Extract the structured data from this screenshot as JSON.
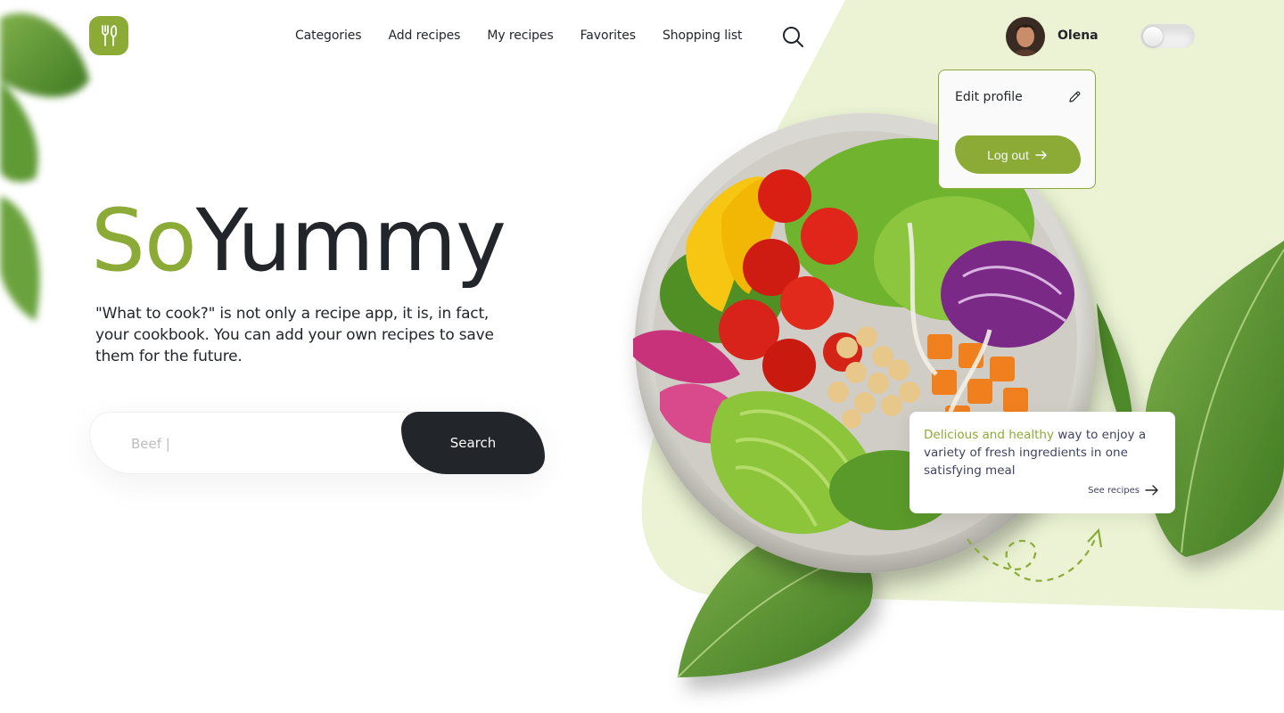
{
  "colors": {
    "accent": "#8baa36",
    "dark": "#22252a",
    "light_green": "#ebf3d4",
    "muted_text": "#bdbdbd"
  },
  "header": {
    "logo_icon": "fork-knife-icon",
    "nav": [
      {
        "label": "Categories"
      },
      {
        "label": "Add recipes"
      },
      {
        "label": "My recipes"
      },
      {
        "label": "Favorites"
      },
      {
        "label": "Shopping list"
      }
    ],
    "search_icon": "search-icon",
    "user": {
      "name": "Olena"
    },
    "theme_toggle": {
      "on": false
    }
  },
  "profile_menu": {
    "edit_label": "Edit profile",
    "edit_icon": "pencil-icon",
    "logout_label": "Log out",
    "logout_icon": "arrow-right-icon"
  },
  "hero": {
    "title_part1": "So",
    "title_part2": "Yummy",
    "description": "\"What to cook?\" is not only a recipe app, it is, in fact, your cookbook. You can add your own recipes to save them for the future.",
    "search": {
      "value": "Beef |",
      "button_label": "Search"
    }
  },
  "info_card": {
    "highlight": "Delicious and healthy",
    "text": " way to enjoy a variety of fresh ingredients in one satisfying meal",
    "link_label": "See recipes"
  }
}
